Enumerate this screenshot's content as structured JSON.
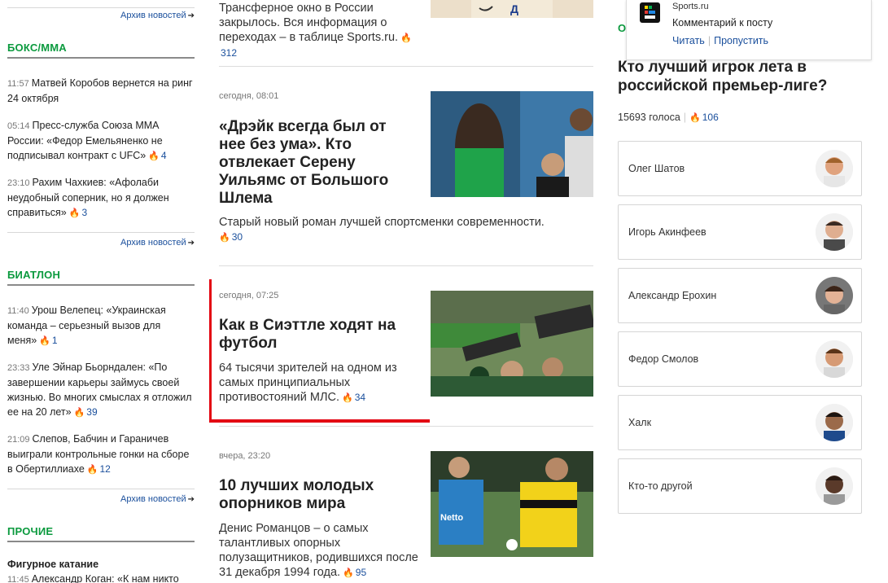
{
  "left": {
    "archive_label": "Архив новостей",
    "sections": [
      {
        "heading": "БОКС/ММА",
        "items": [
          {
            "time": "11:57",
            "text": "Матвей Коробов вернется на ринг 24 октября",
            "count": ""
          },
          {
            "time": "05:14",
            "text": "Пресс-служба Союза ММА России: «Федор Емельяненко не подписывал контракт с UFC»",
            "count": "4"
          },
          {
            "time": "23:10",
            "text": "Рахим Чахкиев: «Афолаби неудобный соперник, но я должен справиться»",
            "count": "3"
          }
        ]
      },
      {
        "heading": "БИАТЛОН",
        "items": [
          {
            "time": "11:40",
            "text": "Урош Велепец: «Украинская команда – серьезный вызов для меня»",
            "count": "1"
          },
          {
            "time": "23:33",
            "text": "Уле Эйнар Бьорндален: «По завершении карьеры займусь своей жизнью. Во многих смыслах я отложил ее на 20 лет»",
            "count": "39"
          },
          {
            "time": "21:09",
            "text": "Слепов, Бабчин и Гараничев выиграли контрольные гонки на сборе в Обертиллиахе",
            "count": "12"
          }
        ]
      },
      {
        "heading": "ПРОЧИЕ",
        "sub": "Фигурное катание",
        "items": [
          {
            "time": "11:45",
            "text": "Александр Коган: «К нам никто",
            "count": ""
          }
        ]
      }
    ]
  },
  "feed": [
    {
      "date": "",
      "title": "",
      "lead": "Трансферное окно в России закрылось. Вся информация о переходах – в таблице Sports.ru.",
      "count": "312",
      "hot": false
    },
    {
      "date": "сегодня, 08:01",
      "title": "«Дрэйк всегда был от нее без ума». Кто отвлекает Серену Уильямс от Большого Шлема",
      "lead": "Старый новый роман лучшей спортсменки современности.",
      "count": "30",
      "hot": false
    },
    {
      "date": "сегодня, 07:25",
      "title": "Как в Сиэттле ходят на футбол",
      "lead": "64 тысячи зрителей на одном из самых принципиальных противостояний МЛС.",
      "count": "34",
      "hot": true
    },
    {
      "date": "вчера, 23:20",
      "title": "10 лучших молодых опорников мира",
      "lead": "Денис Романцов – о самых талантливых опорных полузащитников, родившихся после 31 декабря 1994 года.",
      "count": "95",
      "hot": true
    }
  ],
  "notification": {
    "source": "Sports.ru",
    "message": "Комментарий к посту",
    "read": "Читать",
    "skip": "Пропустить"
  },
  "poll": {
    "tab_label": "О",
    "title": "Кто лучший игрок лета в российской премьер-лиге?",
    "votes": "15693 голоса",
    "count": "106",
    "options": [
      "Олег Шатов",
      "Игорь Акинфеев",
      "Александр Ерохин",
      "Федор Смолов",
      "Халк",
      "Кто-то другой"
    ]
  },
  "colors": {
    "accent_green": "#0b9a3e",
    "link_blue": "#1a4f9c",
    "flame": "#f4a100",
    "hot": "#e53935",
    "highlight_red": "#e30613"
  }
}
